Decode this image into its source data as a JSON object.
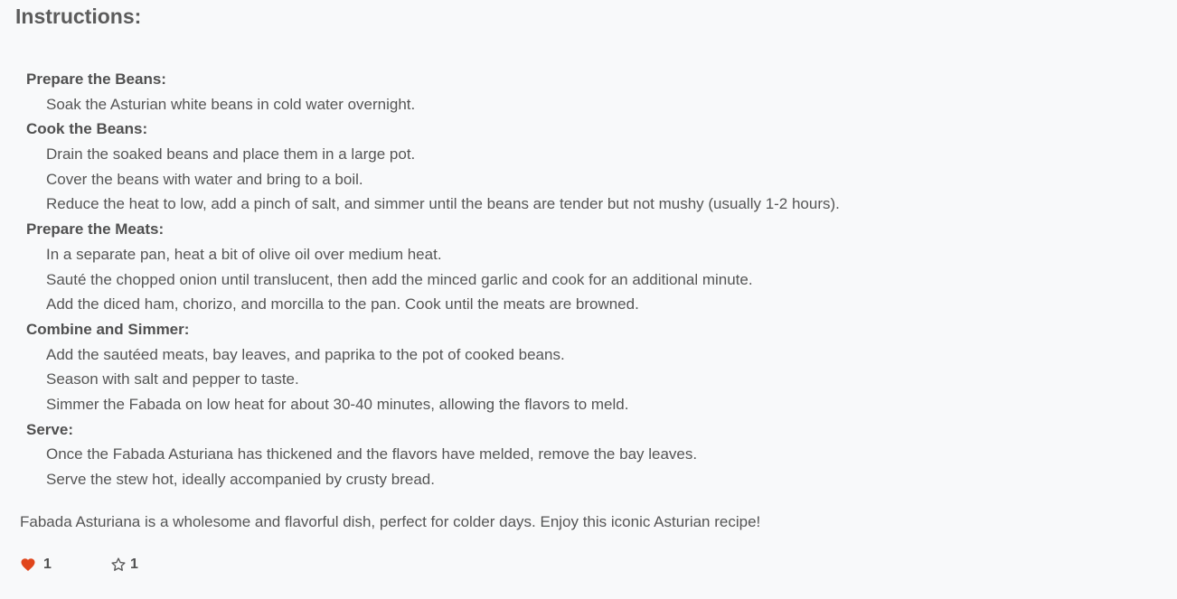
{
  "heading": "Instructions:",
  "sections": [
    {
      "title": "Prepare the Beans:",
      "steps": [
        "Soak the Asturian white beans in cold water overnight."
      ]
    },
    {
      "title": "Cook the Beans:",
      "steps": [
        "Drain the soaked beans and place them in a large pot.",
        "Cover the beans with water and bring to a boil.",
        "Reduce the heat to low, add a pinch of salt, and simmer until the beans are tender but not mushy (usually 1-2 hours)."
      ]
    },
    {
      "title": "Prepare the Meats:",
      "steps": [
        "In a separate pan, heat a bit of olive oil over medium heat.",
        "Sauté the chopped onion until translucent, then add the minced garlic and cook for an additional minute.",
        "Add the diced ham, chorizo, and morcilla to the pan. Cook until the meats are browned."
      ]
    },
    {
      "title": "Combine and Simmer:",
      "steps": [
        "Add the sautéed meats, bay leaves, and paprika to the pot of cooked beans.",
        "Season with salt and pepper to taste.",
        "Simmer the Fabada on low heat for about 30-40 minutes, allowing the flavors to meld."
      ]
    },
    {
      "title": "Serve:",
      "steps": [
        "Once the Fabada Asturiana has thickened and the flavors have melded, remove the bay leaves.",
        "Serve the stew hot, ideally accompanied by crusty bread."
      ]
    }
  ],
  "closing": "Fabada Asturiana is a wholesome and flavorful dish, perfect for colder days. Enjoy this iconic Asturian recipe!",
  "actions": {
    "like": {
      "icon": "heart-icon",
      "count": "1",
      "color": "#e0451b"
    },
    "favorite": {
      "icon": "star-outline-icon",
      "count": "1",
      "color": "#5a5a5a"
    }
  }
}
